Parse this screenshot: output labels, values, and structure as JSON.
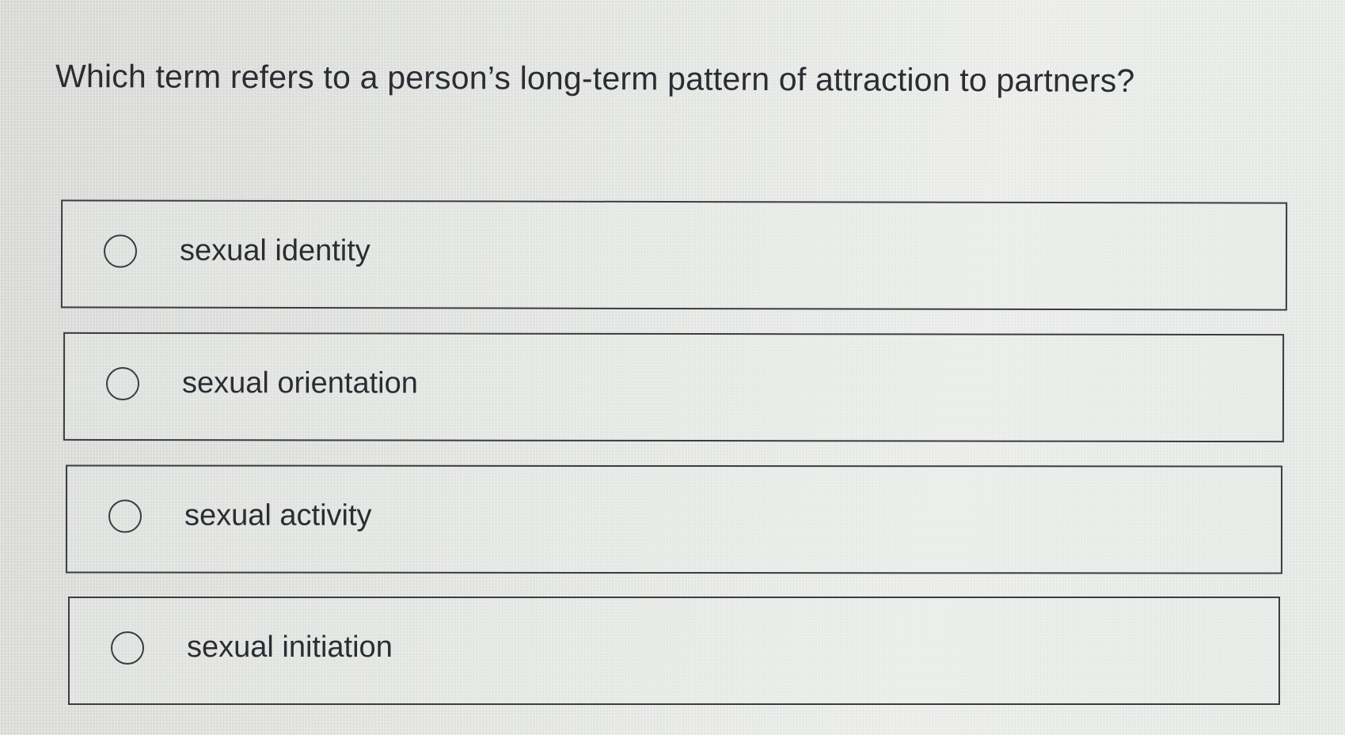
{
  "question": {
    "text": "Which term refers to a person’s long-term pattern of attraction to partners?"
  },
  "options": [
    {
      "label": "sexual identity",
      "selected": false
    },
    {
      "label": "sexual orientation",
      "selected": false
    },
    {
      "label": "sexual activity",
      "selected": false
    },
    {
      "label": "sexual initiation",
      "selected": false
    }
  ],
  "colors": {
    "text": "#2b2d33",
    "border": "#3a3c40",
    "background": "#dfe1df"
  }
}
